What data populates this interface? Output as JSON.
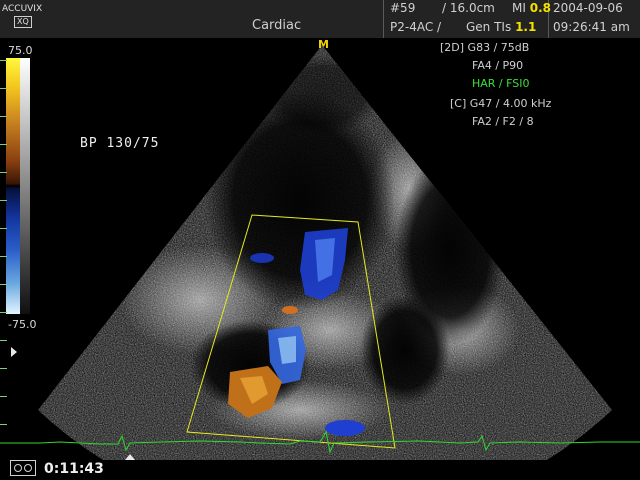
{
  "header": {
    "logo_main": "ACCUVIX",
    "logo_sub": "XQ",
    "title": "Cardiac",
    "image_number": "#59",
    "depth": "/ 16.0cm",
    "mi_label": "MI",
    "mi_value": "0.8",
    "probe_preset": "P2-4AC /",
    "tis_label": "Gen TIs",
    "tis_value": "1.1",
    "date": "2004-09-06",
    "time": "09:26:41 am"
  },
  "info_panel": {
    "line1": "[2D] G83 / 75dB",
    "line2": "FA4 / P90",
    "line3": "HAR / FSI0",
    "line4": "[C] G47 / 4.00 kHz",
    "line5": "FA2 / F2 / 8"
  },
  "velocity_scale": {
    "max_label": "75.0",
    "min_label": "-75.0"
  },
  "annotation": {
    "bp": "BP 130/75"
  },
  "focus_marker": "M",
  "timer": "0:11:43",
  "colors": {
    "header_bg": "#232323",
    "accent_yellow": "#f3e200",
    "ecg_green": "#2fd82f",
    "doppler_blue": "#1e3fd0",
    "doppler_orange": "#c07018"
  },
  "icons": {
    "timer": "cine-loop-icon",
    "marker": "triangle-right-icon",
    "scan_marker": "triangle-up-icon"
  }
}
